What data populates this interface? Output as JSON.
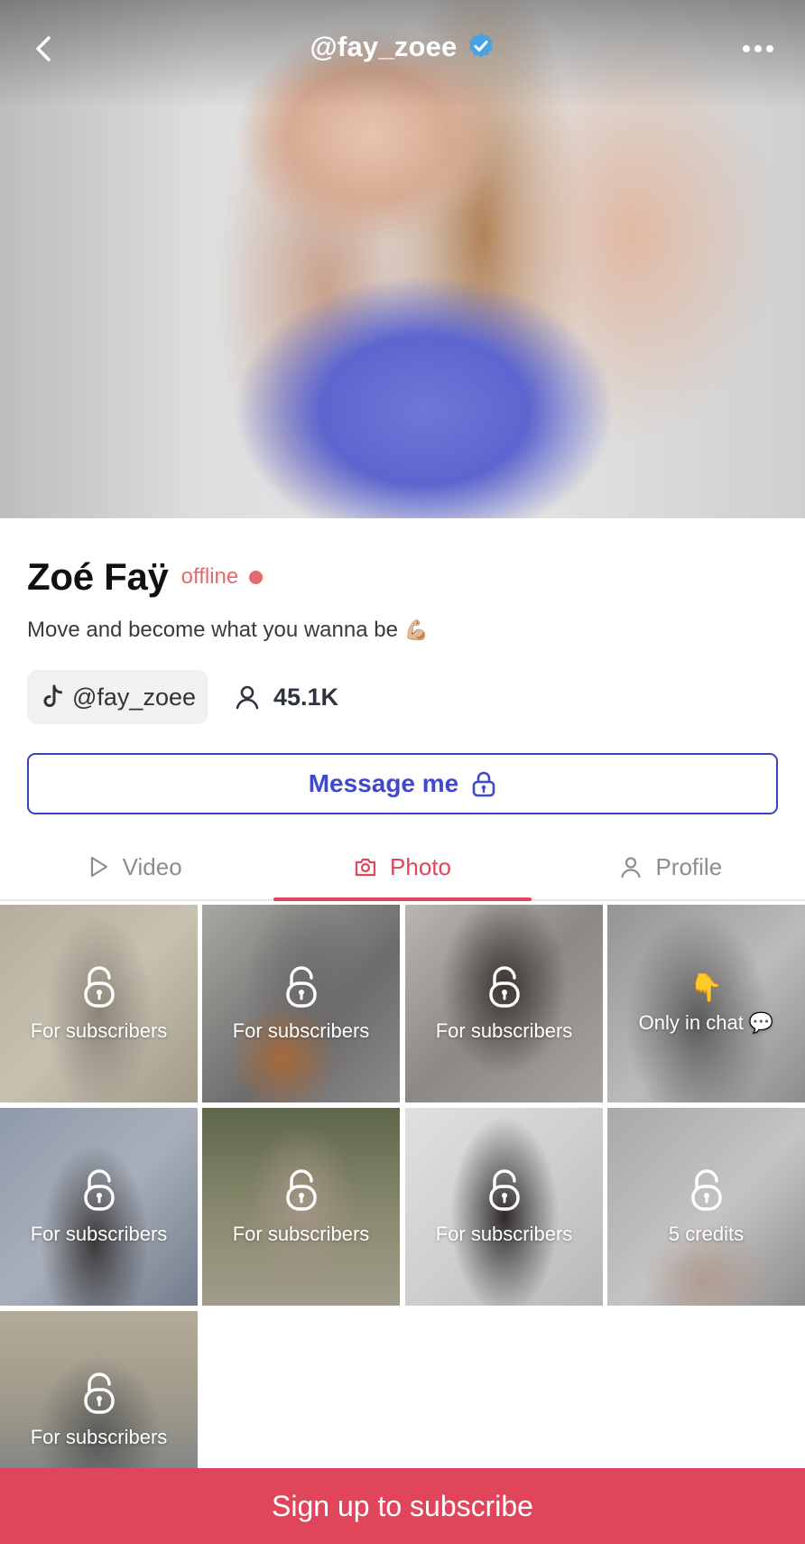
{
  "header": {
    "username": "@fay_zoee",
    "verified": true,
    "icons": {
      "back": "chevron-left-icon",
      "verified": "verified-badge-icon",
      "more": "more-horizontal-icon"
    }
  },
  "profile": {
    "name": "Zoé Faÿ",
    "status": "offline",
    "status_color": "#e56a6a",
    "bio": "Move and become what you wanna be",
    "bio_emoji": "💪🏼",
    "tiktok_handle": "@fay_zoee",
    "followers": "45.1K"
  },
  "actions": {
    "message_label": "Message me",
    "accent": "#4049cc"
  },
  "tabs": [
    {
      "label": "Video",
      "icon": "play-icon",
      "active": false
    },
    {
      "label": "Photo",
      "icon": "camera-icon",
      "active": true
    },
    {
      "label": "Profile",
      "icon": "user-icon",
      "active": false
    }
  ],
  "grid": [
    {
      "label": "For subscribers",
      "icon": "lock-icon"
    },
    {
      "label": "For subscribers",
      "icon": "lock-icon"
    },
    {
      "label": "For subscribers",
      "icon": "lock-icon"
    },
    {
      "label": "Only in chat 💬",
      "icon": "pointing-down-emoji",
      "emoji": "👇"
    },
    {
      "label": "For subscribers",
      "icon": "lock-icon"
    },
    {
      "label": "For subscribers",
      "icon": "lock-icon"
    },
    {
      "label": "For subscribers",
      "icon": "lock-icon"
    },
    {
      "label": "5 credits",
      "icon": "lock-icon"
    },
    {
      "label": "For subscribers",
      "icon": "lock-icon"
    }
  ],
  "cta": {
    "label": "Sign up to subscribe",
    "color": "#e0455c"
  }
}
